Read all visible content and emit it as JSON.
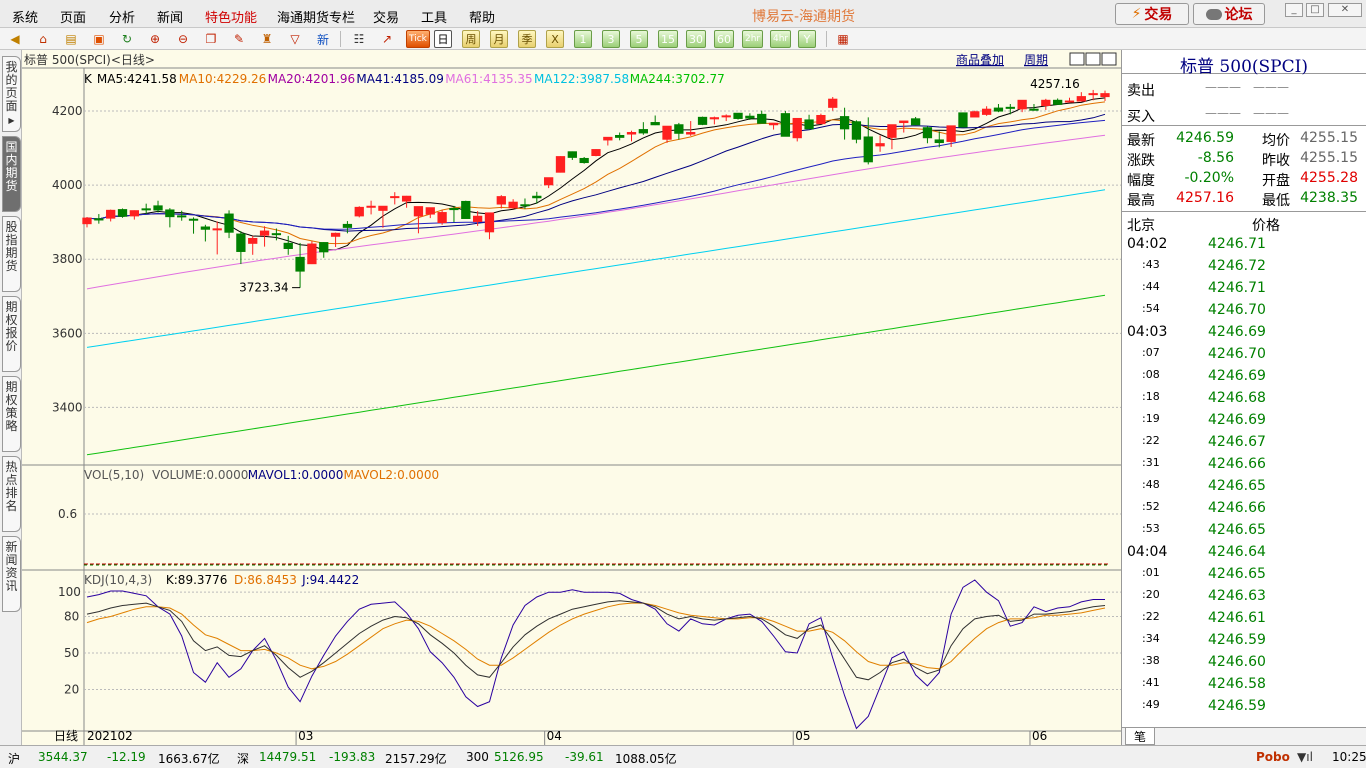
{
  "menu": [
    "系统",
    "页面",
    "分析",
    "新闻",
    "特色功能",
    "海通期货专栏",
    "交易",
    "工具",
    "帮助"
  ],
  "menu_highlight": "特色功能",
  "app_title": "博易云-海通期货",
  "buttons": {
    "trade": "交易",
    "forum": "论坛"
  },
  "toolbar_periods": [
    "Tick",
    "日",
    "周",
    "月",
    "季",
    "X",
    "1",
    "3",
    "5",
    "15",
    "30",
    "60",
    "2hr",
    "4hr",
    "Y"
  ],
  "toolbar_active_period": "日",
  "left_tabs": [
    "我的页面",
    "国内期货",
    "股指期货",
    "期权报价",
    "期权策略",
    "热点排名",
    "新闻资讯"
  ],
  "left_tab_active": "国内期货",
  "chart_header": {
    "symbol": "标普 500(SPCI)<日线>",
    "overlay": "商品叠加",
    "period": "周期"
  },
  "ma_legend": [
    {
      "label": "K",
      "color": "#000000"
    },
    {
      "label": "MA5:4241.58",
      "color": "#000000"
    },
    {
      "label": "MA10:4229.26",
      "color": "#e07000"
    },
    {
      "label": "MA20:4201.96",
      "color": "#a000a0"
    },
    {
      "label": "MA41:4185.09",
      "color": "#000080"
    },
    {
      "label": "MA61:4135.35",
      "color": "#e070e0"
    },
    {
      "label": "MA122:3987.58",
      "color": "#00c0e0"
    },
    {
      "label": "MA244:3702.77",
      "color": "#00c000"
    }
  ],
  "vol_legend": [
    {
      "label": "VOL(5,10)",
      "color": "#555555"
    },
    {
      "label": "VOLUME:0.0000",
      "color": "#555555"
    },
    {
      "label": "MAVOL1:0.0000",
      "color": "#000080"
    },
    {
      "label": "MAVOL2:0.0000",
      "color": "#e07000"
    }
  ],
  "kdj_legend": [
    {
      "label": "KDJ(10,4,3)",
      "color": "#555555"
    },
    {
      "label": "K:89.3776",
      "color": "#000000"
    },
    {
      "label": "D:86.8453",
      "color": "#e07000"
    },
    {
      "label": "J:94.4422",
      "color": "#000080"
    }
  ],
  "chart_data": {
    "type": "candlestick",
    "price_axis": {
      "ticks": [
        4200,
        4000,
        3800,
        3600,
        3400
      ],
      "range": [
        3250,
        4300
      ]
    },
    "vol_axis": {
      "ticks": [
        0.6
      ]
    },
    "kdj_axis": {
      "ticks": [
        100,
        80,
        50,
        20
      ]
    },
    "date_labels": [
      {
        "label": "日线",
        "index": -1
      },
      {
        "label": "202102",
        "index": 0
      },
      {
        "label": "03",
        "index": 18
      },
      {
        "label": "04",
        "index": 39
      },
      {
        "label": "05",
        "index": 60
      },
      {
        "label": "06",
        "index": 80
      }
    ],
    "annotations": {
      "low": "3723.34",
      "high": "4257.16"
    },
    "candles": [
      [
        3896,
        3914,
        3886,
        3911
      ],
      [
        3909,
        3922,
        3896,
        3906
      ],
      [
        3911,
        3934,
        3902,
        3932
      ],
      [
        3934,
        3937,
        3912,
        3916
      ],
      [
        3917,
        3932,
        3907,
        3931
      ],
      [
        3936,
        3950,
        3922,
        3934
      ],
      [
        3944,
        3958,
        3926,
        3933
      ],
      [
        3933,
        3938,
        3886,
        3915
      ],
      [
        3917,
        3931,
        3904,
        3916
      ],
      [
        3908,
        3913,
        3869,
        3906
      ],
      [
        3887,
        3893,
        3848,
        3881
      ],
      [
        3880,
        3902,
        3813,
        3882
      ],
      [
        3922,
        3932,
        3857,
        3873
      ],
      [
        3868,
        3876,
        3787,
        3821
      ],
      [
        3843,
        3863,
        3812,
        3856
      ],
      [
        3865,
        3889,
        3834,
        3876
      ],
      [
        3869,
        3883,
        3851,
        3867
      ],
      [
        3843,
        3863,
        3812,
        3829
      ],
      [
        3805,
        3844,
        3723,
        3768
      ],
      [
        3788,
        3849,
        3787,
        3841
      ],
      [
        3845,
        3846,
        3804,
        3820
      ],
      [
        3862,
        3872,
        3833,
        3870
      ],
      [
        3894,
        3903,
        3870,
        3886
      ],
      [
        3917,
        3943,
        3913,
        3940
      ],
      [
        3942,
        3958,
        3921,
        3943
      ],
      [
        3932,
        3941,
        3885,
        3943
      ],
      [
        3969,
        3981,
        3948,
        3969
      ],
      [
        3957,
        3971,
        3939,
        3970
      ],
      [
        3917,
        3931,
        3870,
        3942
      ],
      [
        3922,
        3930,
        3911,
        3939
      ],
      [
        3899,
        3933,
        3893,
        3926
      ],
      [
        3937,
        3944,
        3900,
        3934
      ],
      [
        3956,
        3958,
        3928,
        3910
      ],
      [
        3902,
        3930,
        3890,
        3916
      ],
      [
        3874,
        3917,
        3854,
        3925
      ],
      [
        3949,
        3973,
        3937,
        3969
      ],
      [
        3939,
        3962,
        3936,
        3954
      ],
      [
        3947,
        3964,
        3936,
        3945
      ],
      [
        3970,
        3982,
        3950,
        3966
      ],
      [
        4001,
        4020,
        3992,
        4020
      ],
      [
        4035,
        4078,
        4034,
        4077
      ],
      [
        4090,
        4091,
        4068,
        4075
      ],
      [
        4072,
        4076,
        4058,
        4061
      ],
      [
        4080,
        4097,
        4078,
        4096
      ],
      [
        4122,
        4129,
        4107,
        4129
      ],
      [
        4134,
        4142,
        4121,
        4129
      ],
      [
        4138,
        4147,
        4118,
        4142
      ],
      [
        4150,
        4170,
        4136,
        4141
      ],
      [
        4169,
        4188,
        4162,
        4163
      ],
      [
        4124,
        4148,
        4114,
        4159
      ],
      [
        4163,
        4168,
        4123,
        4140
      ],
      [
        4138,
        4173,
        4133,
        4142
      ],
      [
        4183,
        4185,
        4162,
        4164
      ],
      [
        4179,
        4185,
        4164,
        4182
      ],
      [
        4187,
        4191,
        4173,
        4187
      ],
      [
        4194,
        4194,
        4177,
        4180
      ],
      [
        4186,
        4194,
        4176,
        4181
      ],
      [
        4191,
        4201,
        4170,
        4167
      ],
      [
        4163,
        4167,
        4150,
        4167
      ],
      [
        4193,
        4200,
        4163,
        4132
      ],
      [
        4128,
        4172,
        4118,
        4180
      ],
      [
        4176,
        4190,
        4158,
        4152
      ],
      [
        4166,
        4193,
        4169,
        4188
      ],
      [
        4210,
        4238,
        4201,
        4232
      ],
      [
        4185,
        4209,
        4123,
        4152
      ],
      [
        4171,
        4175,
        4113,
        4124
      ],
      [
        4130,
        4183,
        4056,
        4063
      ],
      [
        4106,
        4134,
        4090,
        4112
      ],
      [
        4129,
        4135,
        4097,
        4163
      ],
      [
        4169,
        4171,
        4142,
        4173
      ],
      [
        4179,
        4184,
        4166,
        4163
      ],
      [
        4155,
        4159,
        4113,
        4128
      ],
      [
        4122,
        4145,
        4102,
        4115
      ],
      [
        4118,
        4156,
        4103,
        4160
      ],
      [
        4195,
        4196,
        4187,
        4157
      ],
      [
        4184,
        4201,
        4184,
        4198
      ],
      [
        4191,
        4213,
        4187,
        4205
      ],
      [
        4208,
        4219,
        4197,
        4200
      ],
      [
        4210,
        4219,
        4191,
        4208
      ],
      [
        4206,
        4208,
        4197,
        4229
      ],
      [
        4205,
        4219,
        4201,
        4204
      ],
      [
        4215,
        4233,
        4203,
        4229
      ],
      [
        4229,
        4234,
        4218,
        4218
      ],
      [
        4227,
        4236,
        4225,
        4227
      ],
      [
        4227,
        4251,
        4225,
        4239
      ],
      [
        4246,
        4257,
        4229,
        4247
      ],
      [
        4239,
        4255,
        4227,
        4247
      ]
    ],
    "kdj": {
      "k": [
        82,
        84,
        87,
        89,
        90,
        91,
        88,
        85,
        76,
        60,
        52,
        55,
        48,
        47,
        52,
        56,
        48,
        38,
        30,
        35,
        42,
        50,
        58,
        66,
        72,
        77,
        80,
        79,
        74,
        65,
        58,
        50,
        40,
        32,
        30,
        42,
        55,
        65,
        72,
        78,
        82,
        86,
        88,
        90,
        92,
        93,
        92,
        91,
        88,
        82,
        78,
        80,
        78,
        77,
        78,
        79,
        80,
        78,
        72,
        65,
        62,
        70,
        73,
        60,
        45,
        30,
        28,
        34,
        42,
        45,
        38,
        33,
        36,
        56,
        70,
        78,
        80,
        81,
        76,
        77,
        82,
        82,
        83,
        84,
        86,
        88,
        89
      ],
      "d": [
        75,
        78,
        80,
        83,
        86,
        88,
        88,
        87,
        82,
        73,
        65,
        62,
        57,
        52,
        52,
        53,
        50,
        46,
        40,
        37,
        39,
        43,
        49,
        56,
        63,
        70,
        74,
        77,
        76,
        72,
        66,
        60,
        53,
        45,
        40,
        40,
        46,
        53,
        60,
        67,
        73,
        78,
        82,
        85,
        88,
        90,
        91,
        91,
        89,
        86,
        83,
        81,
        80,
        79,
        78,
        78,
        79,
        79,
        76,
        72,
        68,
        68,
        70,
        67,
        60,
        51,
        43,
        40,
        40,
        42,
        41,
        38,
        37,
        43,
        53,
        62,
        70,
        75,
        78,
        78,
        79,
        81,
        81,
        82,
        83,
        85,
        87
      ],
      "j": [
        96,
        98,
        101,
        101,
        99,
        97,
        88,
        82,
        64,
        34,
        26,
        42,
        30,
        37,
        52,
        62,
        44,
        22,
        10,
        31,
        48,
        64,
        76,
        86,
        90,
        91,
        92,
        83,
        70,
        51,
        42,
        30,
        14,
        6,
        10,
        46,
        73,
        89,
        96,
        100,
        100,
        102,
        100,
        100,
        100,
        99,
        94,
        91,
        86,
        74,
        68,
        78,
        74,
        73,
        78,
        81,
        82,
        76,
        64,
        51,
        50,
        74,
        79,
        46,
        15,
        -12,
        -2,
        22,
        46,
        51,
        32,
        23,
        34,
        82,
        104,
        110,
        100,
        93,
        72,
        75,
        88,
        84,
        87,
        88,
        92,
        94,
        94
      ]
    }
  },
  "quote": {
    "title": "标普 500(SPCI)",
    "sell_label": "卖出",
    "sell_price": "———",
    "sell_vol": "———",
    "buy_label": "买入",
    "buy_price": "———",
    "buy_vol": "———",
    "rows": [
      {
        "l1": "最新",
        "v1": "4246.59",
        "c1": "grn",
        "l2": "均价",
        "v2": "4255.15",
        "c2": "gray"
      },
      {
        "l1": "涨跌",
        "v1": "-8.56",
        "c1": "grn",
        "l2": "昨收",
        "v2": "4255.15",
        "c2": "gray"
      },
      {
        "l1": "幅度",
        "v1": "-0.20%",
        "c1": "grn",
        "l2": "开盘",
        "v2": "4255.28",
        "c2": "red"
      },
      {
        "l1": "最高",
        "v1": "4257.16",
        "c1": "red",
        "l2": "最低",
        "v2": "4238.35",
        "c2": "grn"
      }
    ],
    "tick_header": {
      "time": "北京",
      "price": "价格"
    },
    "ticks": [
      {
        "time": "04:02",
        "price": "4246.71",
        "major": true
      },
      {
        "time": ":43",
        "price": "4246.72",
        "major": false
      },
      {
        "time": ":44",
        "price": "4246.71",
        "major": false
      },
      {
        "time": ":54",
        "price": "4246.70",
        "major": false
      },
      {
        "time": "04:03",
        "price": "4246.69",
        "major": true
      },
      {
        "time": ":07",
        "price": "4246.70",
        "major": false
      },
      {
        "time": ":08",
        "price": "4246.69",
        "major": false
      },
      {
        "time": ":18",
        "price": "4246.68",
        "major": false
      },
      {
        "time": ":19",
        "price": "4246.69",
        "major": false
      },
      {
        "time": ":22",
        "price": "4246.67",
        "major": false
      },
      {
        "time": ":31",
        "price": "4246.66",
        "major": false
      },
      {
        "time": ":48",
        "price": "4246.65",
        "major": false
      },
      {
        "time": ":52",
        "price": "4246.66",
        "major": false
      },
      {
        "time": ":53",
        "price": "4246.65",
        "major": false
      },
      {
        "time": "04:04",
        "price": "4246.64",
        "major": true
      },
      {
        "time": ":01",
        "price": "4246.65",
        "major": false
      },
      {
        "time": ":20",
        "price": "4246.63",
        "major": false
      },
      {
        "time": ":22",
        "price": "4246.61",
        "major": false
      },
      {
        "time": ":34",
        "price": "4246.59",
        "major": false
      },
      {
        "time": ":38",
        "price": "4246.60",
        "major": false
      },
      {
        "time": ":41",
        "price": "4246.58",
        "major": false
      },
      {
        "time": ":49",
        "price": "4246.59",
        "major": false
      }
    ],
    "bottom_tab": "笔"
  },
  "status": {
    "sh_label": "沪",
    "sh_price": "3544.37",
    "sh_chg": "-12.19",
    "sh_amt": "1663.67亿",
    "sz_label": "深",
    "sz_price": "14479.51",
    "sz_chg": "-193.83",
    "sz_amt": "2157.29亿",
    "c300_label": "300",
    "c300_price": "5126.95",
    "c300_chg": "-39.61",
    "c300_amt": "1088.05亿",
    "brand": "Pobo",
    "time": "10:25"
  }
}
